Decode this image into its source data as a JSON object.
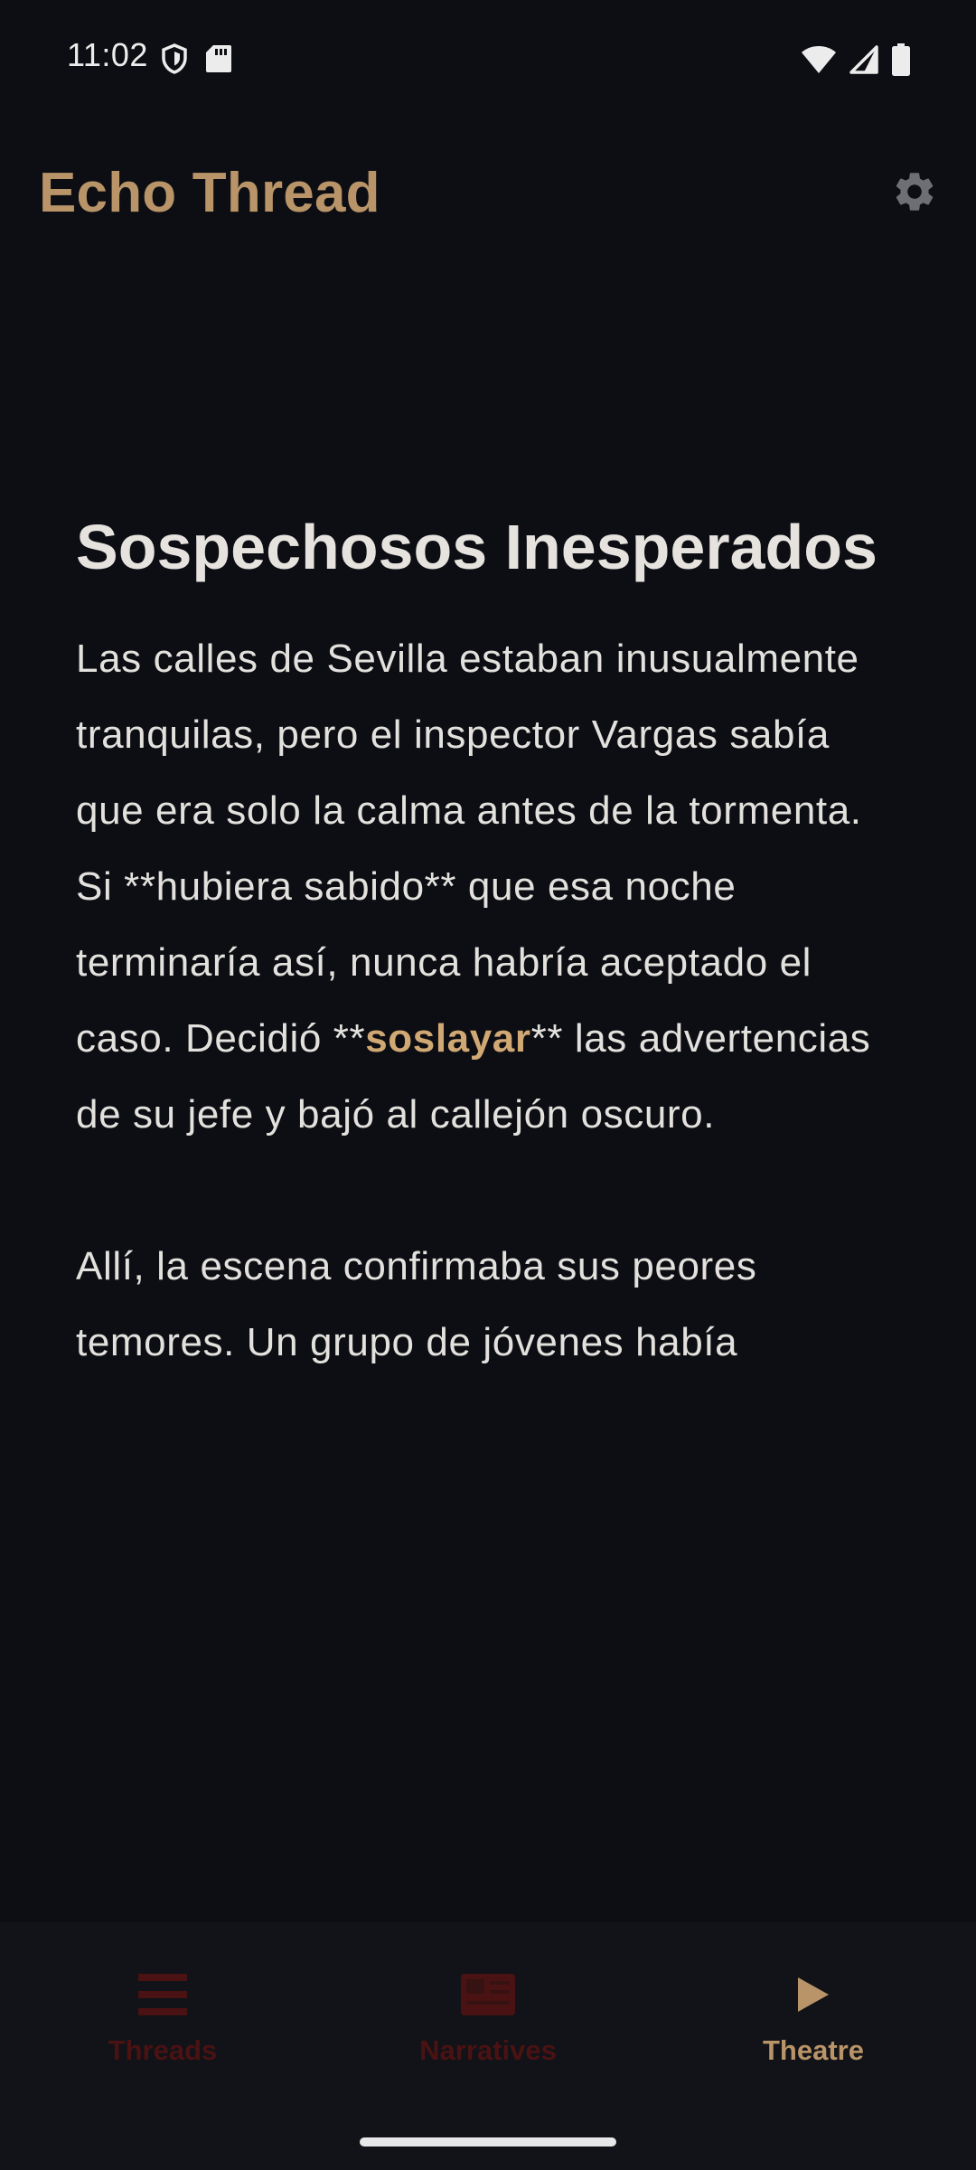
{
  "status_bar": {
    "time": "11:02",
    "left_icons": [
      "shield-icon",
      "sd-card-icon"
    ],
    "right_icons": [
      "wifi-icon",
      "signal-icon",
      "battery-icon"
    ]
  },
  "header": {
    "title": "Echo Thread",
    "settings_icon": "gear-icon"
  },
  "reader": {
    "chapter_title": "Sospechosos Inesperados",
    "paragraph1": {
      "before": "Las calles de Sevilla estaban inusualmente tranquilas, pero el inspector Vargas sabía que era solo la calma antes de la tormenta. Si **hubiera sabido** que esa noche terminaría así, nunca habría aceptado el caso. Decidió **",
      "highlight": "soslayar",
      "after": "** las advertencias de su jefe y bajó al callejón oscuro."
    },
    "paragraph2": "Allí, la escena confirmaba sus peores temores. Un grupo de jóvenes había"
  },
  "bottom_nav": {
    "items": [
      {
        "label": "Threads",
        "icon": "list-icon",
        "active": false
      },
      {
        "label": "Narratives",
        "icon": "newspaper-icon",
        "active": false
      },
      {
        "label": "Theatre",
        "icon": "play-icon",
        "active": true
      }
    ]
  },
  "colors": {
    "background": "#0d0e13",
    "accent": "#b89468",
    "highlight": "#d0a874",
    "text": "#e3e1dd",
    "inactive_nav": "#4a1212",
    "nav_background": "#121318"
  }
}
